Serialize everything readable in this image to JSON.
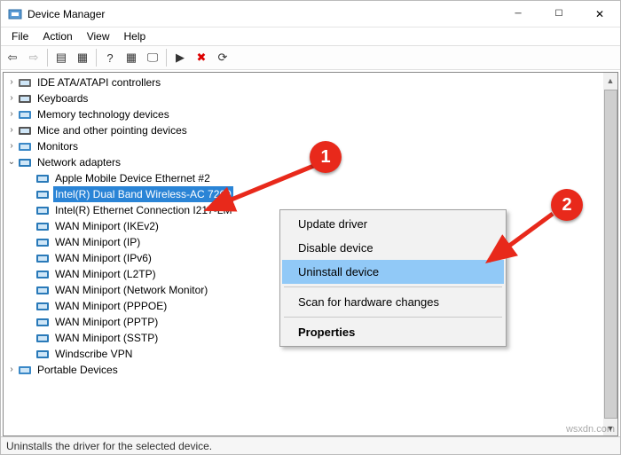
{
  "window": {
    "title": "Device Manager"
  },
  "menus": [
    "File",
    "Action",
    "View",
    "Help"
  ],
  "toolbar_icons": [
    {
      "name": "back-icon",
      "glyph": "⇦",
      "disabled": false
    },
    {
      "name": "forward-icon",
      "glyph": "⇨",
      "disabled": true
    },
    {
      "name": "sep"
    },
    {
      "name": "show-hidden-icon",
      "glyph": "▤"
    },
    {
      "name": "view-icon",
      "glyph": "▦"
    },
    {
      "name": "sep"
    },
    {
      "name": "help-icon",
      "glyph": "?"
    },
    {
      "name": "props-icon",
      "glyph": "▦"
    },
    {
      "name": "scan-icon",
      "glyph": "🖵"
    },
    {
      "name": "sep"
    },
    {
      "name": "enable-icon",
      "glyph": "▶"
    },
    {
      "name": "delete-icon",
      "glyph": "✖",
      "color": "#d00"
    },
    {
      "name": "refresh-icon",
      "glyph": "⟳"
    }
  ],
  "tree": [
    {
      "label": "IDE ATA/ATAPI controllers",
      "twisty": ">",
      "icon": "ide"
    },
    {
      "label": "Keyboards",
      "twisty": ">",
      "icon": "kb"
    },
    {
      "label": "Memory technology devices",
      "twisty": ">",
      "icon": "mem"
    },
    {
      "label": "Mice and other pointing devices",
      "twisty": ">",
      "icon": "mouse"
    },
    {
      "label": "Monitors",
      "twisty": ">",
      "icon": "mon"
    },
    {
      "label": "Network adapters",
      "twisty": "v",
      "icon": "net",
      "expanded": true,
      "children": [
        {
          "label": "Apple Mobile Device Ethernet #2",
          "icon": "net"
        },
        {
          "label": "Intel(R) Dual Band Wireless-AC 7260",
          "icon": "net",
          "selected": true
        },
        {
          "label": "Intel(R) Ethernet Connection I217-LM",
          "icon": "net"
        },
        {
          "label": "WAN Miniport (IKEv2)",
          "icon": "net"
        },
        {
          "label": "WAN Miniport (IP)",
          "icon": "net"
        },
        {
          "label": "WAN Miniport (IPv6)",
          "icon": "net"
        },
        {
          "label": "WAN Miniport (L2TP)",
          "icon": "net"
        },
        {
          "label": "WAN Miniport (Network Monitor)",
          "icon": "net"
        },
        {
          "label": "WAN Miniport (PPPOE)",
          "icon": "net"
        },
        {
          "label": "WAN Miniport (PPTP)",
          "icon": "net"
        },
        {
          "label": "WAN Miniport (SSTP)",
          "icon": "net"
        },
        {
          "label": "Windscribe VPN",
          "icon": "net"
        }
      ]
    },
    {
      "label": "Portable Devices",
      "twisty": ">",
      "icon": "port"
    }
  ],
  "context_menu": {
    "items": [
      {
        "label": "Update driver"
      },
      {
        "label": "Disable device"
      },
      {
        "label": "Uninstall device",
        "highlight": true
      },
      {
        "sep": true
      },
      {
        "label": "Scan for hardware changes"
      },
      {
        "sep": true
      },
      {
        "label": "Properties",
        "bold": true
      }
    ]
  },
  "status": "Uninstalls the driver for the selected device.",
  "callouts": {
    "c1": "1",
    "c2": "2"
  },
  "watermark": "wsxdn.com"
}
